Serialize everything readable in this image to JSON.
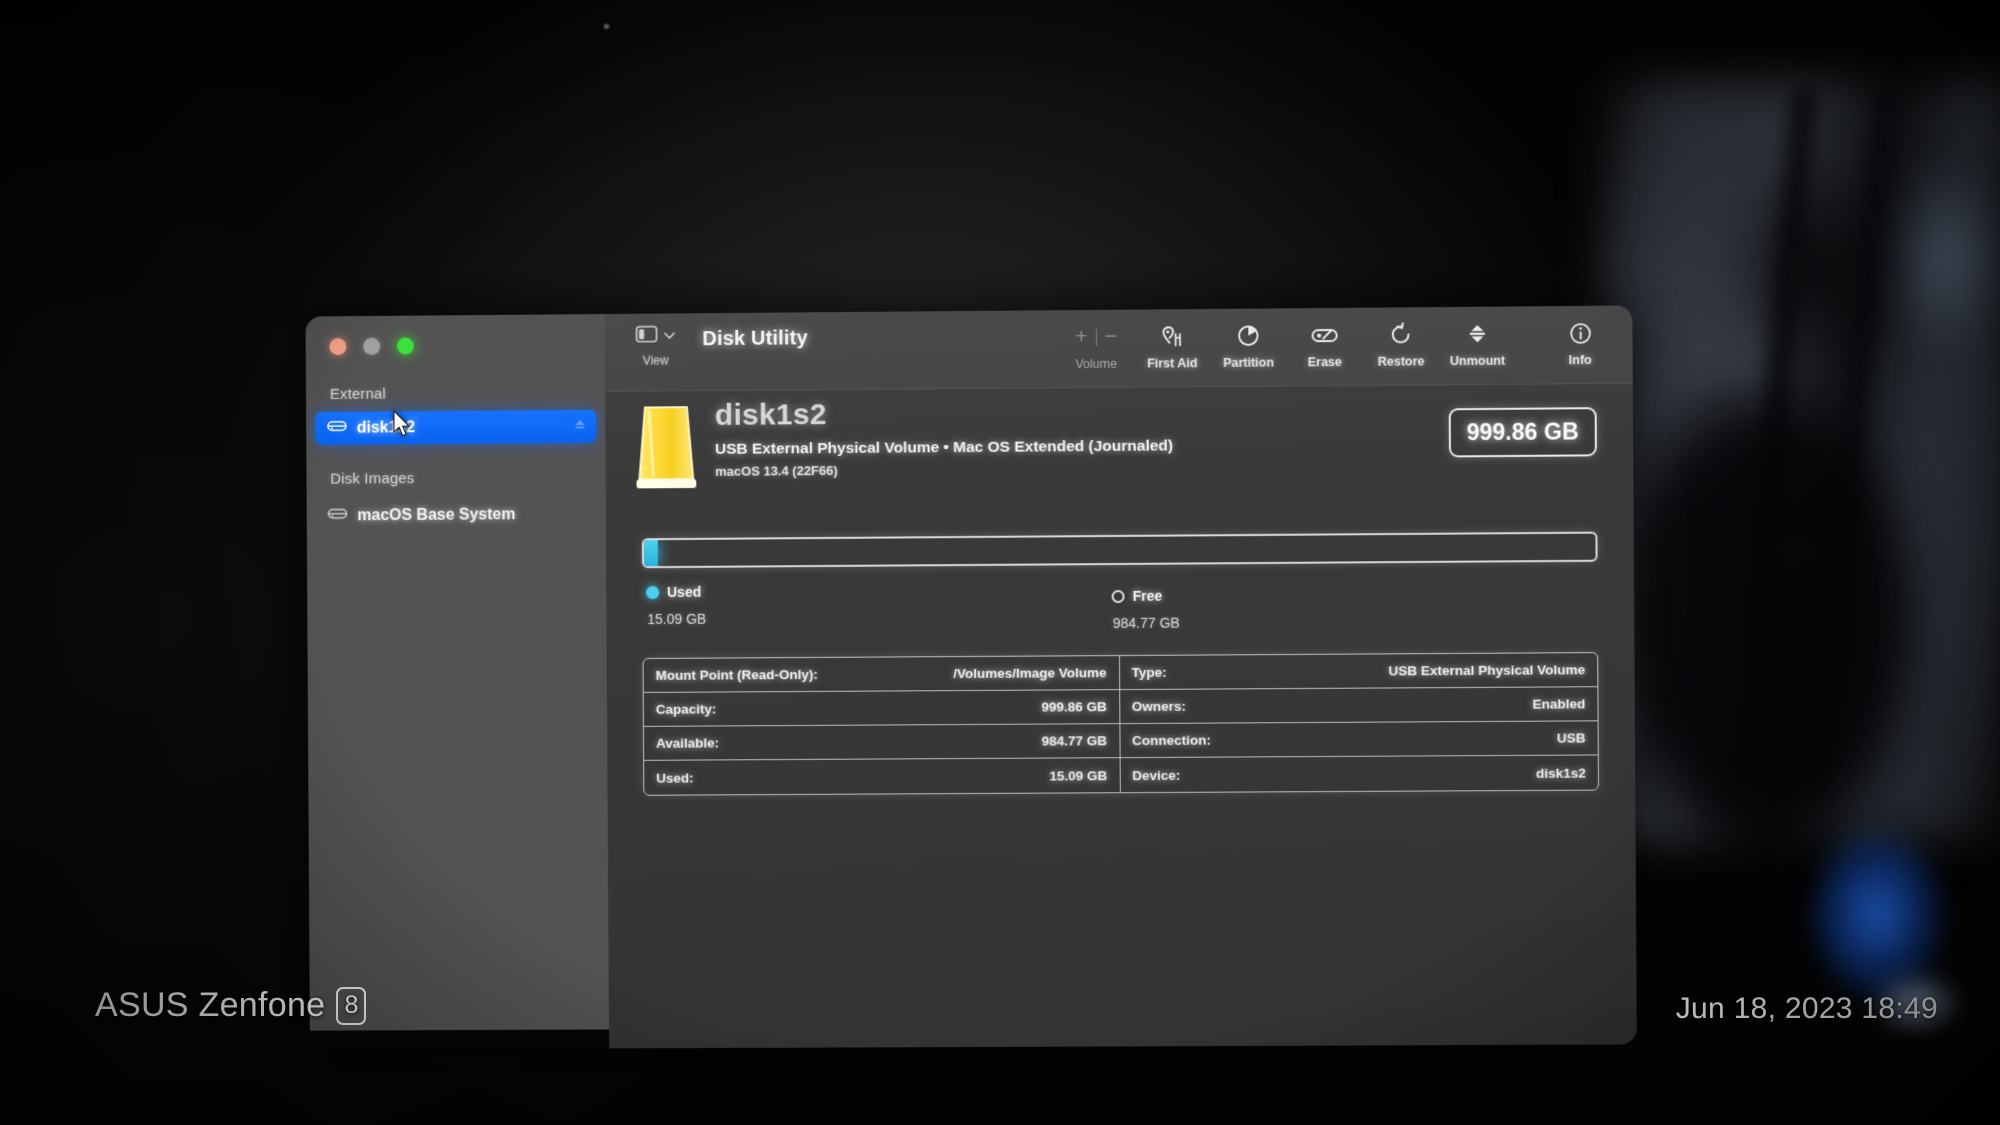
{
  "window": {
    "app_title": "Disk Utility",
    "traffic_lights": [
      "close-button",
      "minimize-button",
      "zoom-button"
    ]
  },
  "toolbar": {
    "view": {
      "label": "View",
      "icon": "sidebar-toggle-icon",
      "chevron": "chevron-down-icon"
    },
    "items": [
      {
        "label": "Volume",
        "icon": "plus-minus-icon",
        "enabled": false
      },
      {
        "label": "First Aid",
        "icon": "first-aid-icon",
        "enabled": true
      },
      {
        "label": "Partition",
        "icon": "partition-icon",
        "enabled": true
      },
      {
        "label": "Erase",
        "icon": "erase-disk-icon",
        "enabled": true
      },
      {
        "label": "Restore",
        "icon": "restore-icon",
        "enabled": true
      },
      {
        "label": "Unmount",
        "icon": "unmount-icon",
        "enabled": true
      },
      {
        "label": "Info",
        "icon": "info-circle-icon",
        "enabled": true
      }
    ]
  },
  "sidebar": {
    "sections": [
      {
        "header": "External",
        "items": [
          {
            "label": "disk1s2",
            "icon": "external-drive-icon",
            "selected": true,
            "eject": "eject-icon"
          }
        ]
      },
      {
        "header": "Disk Images",
        "items": [
          {
            "label": "macOS Base System",
            "icon": "disk-image-icon",
            "selected": false
          }
        ]
      }
    ]
  },
  "volume": {
    "icon": "yellow-external-drive-icon",
    "name": "disk1s2",
    "subtitle": "USB External Physical Volume • Mac OS Extended (Journaled)",
    "os_version": "macOS 13.4 (22F66)",
    "capacity_badge": "999.86 GB"
  },
  "usage": {
    "used_percent": 1.5,
    "legend": [
      {
        "name": "Used",
        "value": "15.09 GB",
        "swatch": "cyan"
      },
      {
        "name": "Free",
        "value": "984.77 GB",
        "swatch": "hollow"
      }
    ]
  },
  "info_table": {
    "left": [
      {
        "key": "Mount Point (Read-Only):",
        "value": "/Volumes/Image Volume"
      },
      {
        "key": "Capacity:",
        "value": "999.86 GB"
      },
      {
        "key": "Available:",
        "value": "984.77 GB"
      },
      {
        "key": "Used:",
        "value": "15.09 GB"
      }
    ],
    "right": [
      {
        "key": "Type:",
        "value": "USB External Physical Volume"
      },
      {
        "key": "Owners:",
        "value": "Enabled"
      },
      {
        "key": "Connection:",
        "value": "USB"
      },
      {
        "key": "Device:",
        "value": "disk1s2"
      }
    ]
  },
  "watermark": {
    "device_text": "ASUS Zenfone",
    "device_badge": "8",
    "timestamp": "Jun 18, 2023 18:49"
  },
  "colors": {
    "selection_blue": "#0a62ef",
    "used_cyan": "#4fd4f2",
    "drive_yellow": "#f5d53a",
    "window_bg": "#3b3a3a",
    "sidebar_bg": "#545353"
  }
}
